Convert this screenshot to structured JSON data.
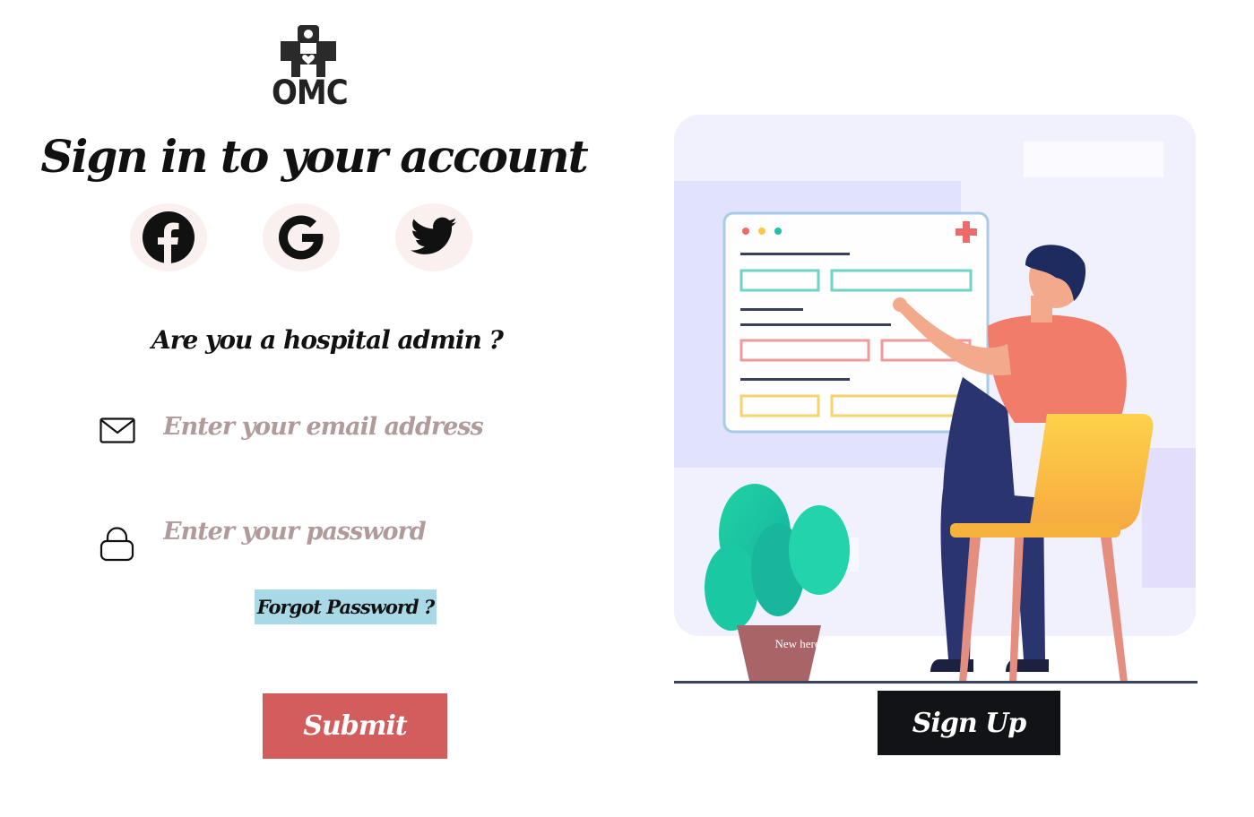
{
  "brand": {
    "logo_text": "OMC"
  },
  "title": "Sign in to your account",
  "social": [
    {
      "icon": "facebook-icon"
    },
    {
      "icon": "google-icon"
    },
    {
      "icon": "twitter-icon"
    }
  ],
  "admin_question": "Are you a hospital admin ?",
  "form": {
    "email": {
      "placeholder": "Enter your email address",
      "value": "",
      "icon": "envelope-icon"
    },
    "password": {
      "placeholder": "Enter your password",
      "value": "",
      "icon": "lock-icon"
    },
    "forgot_label": "Forgot Password ?",
    "submit_label": "Submit"
  },
  "signup_section": {
    "prompt": "New here ? create a new account",
    "signup_label": "Sign Up"
  },
  "colors": {
    "submit_bg": "#d35c5c",
    "signup_bg": "#121316",
    "forgot_bg": "#a9d8e6",
    "social_bg": "#faf0f0",
    "placeholder": "#b09a9a"
  }
}
